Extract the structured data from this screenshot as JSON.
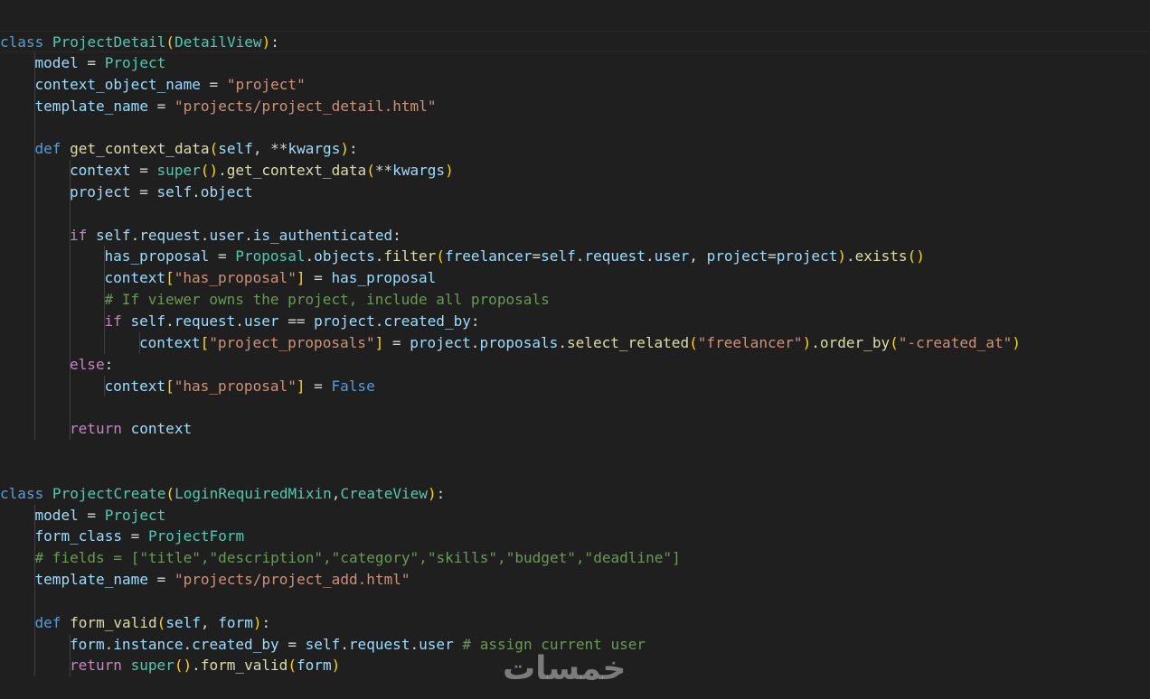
{
  "colors": {
    "background": "#1f1f1f",
    "keyword": "#569cd6",
    "control": "#c586c0",
    "class": "#4ec9b0",
    "function": "#dcdcaa",
    "variable": "#9cdcfe",
    "string": "#ce9178",
    "comment": "#6a9955",
    "bracket_level_1": "#ffd700",
    "bracket_level_2": "#da70d6",
    "bracket_level_3": "#179fff"
  },
  "watermark_text": "خمسات",
  "lines": [
    {
      "indent": 0,
      "current": true,
      "tokens": [
        {
          "t": "class",
          "c": "kw"
        },
        {
          "t": " ",
          "c": "op"
        },
        {
          "t": "ProjectDetail",
          "c": "cls"
        },
        {
          "t": "(",
          "c": "b1"
        },
        {
          "t": "DetailView",
          "c": "cls"
        },
        {
          "t": ")",
          "c": "b1"
        },
        {
          "t": ":",
          "c": "op"
        }
      ]
    },
    {
      "indent": 1,
      "tokens": [
        {
          "t": "model",
          "c": "var"
        },
        {
          "t": " = ",
          "c": "op"
        },
        {
          "t": "Project",
          "c": "cls"
        }
      ]
    },
    {
      "indent": 1,
      "tokens": [
        {
          "t": "context_object_name",
          "c": "var"
        },
        {
          "t": " = ",
          "c": "op"
        },
        {
          "t": "\"project\"",
          "c": "str"
        }
      ]
    },
    {
      "indent": 1,
      "tokens": [
        {
          "t": "template_name",
          "c": "var"
        },
        {
          "t": " = ",
          "c": "op"
        },
        {
          "t": "\"projects/project_detail.html\"",
          "c": "str"
        }
      ]
    },
    {
      "indent": 0,
      "guides": 1,
      "tokens": []
    },
    {
      "indent": 1,
      "tokens": [
        {
          "t": "def",
          "c": "kw"
        },
        {
          "t": " ",
          "c": "op"
        },
        {
          "t": "get_context_data",
          "c": "fn"
        },
        {
          "t": "(",
          "c": "b1"
        },
        {
          "t": "self",
          "c": "var"
        },
        {
          "t": ", **",
          "c": "op"
        },
        {
          "t": "kwargs",
          "c": "var"
        },
        {
          "t": ")",
          "c": "b1"
        },
        {
          "t": ":",
          "c": "op"
        }
      ]
    },
    {
      "indent": 2,
      "tokens": [
        {
          "t": "context",
          "c": "var"
        },
        {
          "t": " = ",
          "c": "op"
        },
        {
          "t": "super",
          "c": "cls"
        },
        {
          "t": "(",
          "c": "b1"
        },
        {
          "t": ")",
          "c": "b1"
        },
        {
          "t": ".",
          "c": "op"
        },
        {
          "t": "get_context_data",
          "c": "fn"
        },
        {
          "t": "(",
          "c": "b1"
        },
        {
          "t": "**",
          "c": "op"
        },
        {
          "t": "kwargs",
          "c": "var"
        },
        {
          "t": ")",
          "c": "b1"
        }
      ]
    },
    {
      "indent": 2,
      "tokens": [
        {
          "t": "project",
          "c": "var"
        },
        {
          "t": " = ",
          "c": "op"
        },
        {
          "t": "self",
          "c": "var"
        },
        {
          "t": ".",
          "c": "op"
        },
        {
          "t": "object",
          "c": "var"
        }
      ]
    },
    {
      "indent": 0,
      "guides": 2,
      "tokens": []
    },
    {
      "indent": 2,
      "tokens": [
        {
          "t": "if",
          "c": "ctl"
        },
        {
          "t": " ",
          "c": "op"
        },
        {
          "t": "self",
          "c": "var"
        },
        {
          "t": ".",
          "c": "op"
        },
        {
          "t": "request",
          "c": "var"
        },
        {
          "t": ".",
          "c": "op"
        },
        {
          "t": "user",
          "c": "var"
        },
        {
          "t": ".",
          "c": "op"
        },
        {
          "t": "is_authenticated",
          "c": "var"
        },
        {
          "t": ":",
          "c": "op"
        }
      ]
    },
    {
      "indent": 3,
      "tokens": [
        {
          "t": "has_proposal",
          "c": "var"
        },
        {
          "t": " = ",
          "c": "op"
        },
        {
          "t": "Proposal",
          "c": "cls"
        },
        {
          "t": ".",
          "c": "op"
        },
        {
          "t": "objects",
          "c": "var"
        },
        {
          "t": ".",
          "c": "op"
        },
        {
          "t": "filter",
          "c": "fn"
        },
        {
          "t": "(",
          "c": "b1"
        },
        {
          "t": "freelancer",
          "c": "var"
        },
        {
          "t": "=",
          "c": "op"
        },
        {
          "t": "self",
          "c": "var"
        },
        {
          "t": ".",
          "c": "op"
        },
        {
          "t": "request",
          "c": "var"
        },
        {
          "t": ".",
          "c": "op"
        },
        {
          "t": "user",
          "c": "var"
        },
        {
          "t": ", ",
          "c": "op"
        },
        {
          "t": "project",
          "c": "var"
        },
        {
          "t": "=",
          "c": "op"
        },
        {
          "t": "project",
          "c": "var"
        },
        {
          "t": ")",
          "c": "b1"
        },
        {
          "t": ".",
          "c": "op"
        },
        {
          "t": "exists",
          "c": "fn"
        },
        {
          "t": "(",
          "c": "b1"
        },
        {
          "t": ")",
          "c": "b1"
        }
      ]
    },
    {
      "indent": 3,
      "tokens": [
        {
          "t": "context",
          "c": "var"
        },
        {
          "t": "[",
          "c": "b1"
        },
        {
          "t": "\"has_proposal\"",
          "c": "str"
        },
        {
          "t": "]",
          "c": "b1"
        },
        {
          "t": " = ",
          "c": "op"
        },
        {
          "t": "has_proposal",
          "c": "var"
        }
      ]
    },
    {
      "indent": 3,
      "tokens": [
        {
          "t": "# If viewer owns the project, include all proposals",
          "c": "cmt"
        }
      ]
    },
    {
      "indent": 3,
      "tokens": [
        {
          "t": "if",
          "c": "ctl"
        },
        {
          "t": " ",
          "c": "op"
        },
        {
          "t": "self",
          "c": "var"
        },
        {
          "t": ".",
          "c": "op"
        },
        {
          "t": "request",
          "c": "var"
        },
        {
          "t": ".",
          "c": "op"
        },
        {
          "t": "user",
          "c": "var"
        },
        {
          "t": " == ",
          "c": "op"
        },
        {
          "t": "project",
          "c": "var"
        },
        {
          "t": ".",
          "c": "op"
        },
        {
          "t": "created_by",
          "c": "var"
        },
        {
          "t": ":",
          "c": "op"
        }
      ]
    },
    {
      "indent": 4,
      "tokens": [
        {
          "t": "context",
          "c": "var"
        },
        {
          "t": "[",
          "c": "b1"
        },
        {
          "t": "\"project_proposals\"",
          "c": "str"
        },
        {
          "t": "]",
          "c": "b1"
        },
        {
          "t": " = ",
          "c": "op"
        },
        {
          "t": "project",
          "c": "var"
        },
        {
          "t": ".",
          "c": "op"
        },
        {
          "t": "proposals",
          "c": "var"
        },
        {
          "t": ".",
          "c": "op"
        },
        {
          "t": "select_related",
          "c": "fn"
        },
        {
          "t": "(",
          "c": "b1"
        },
        {
          "t": "\"freelancer\"",
          "c": "str"
        },
        {
          "t": ")",
          "c": "b1"
        },
        {
          "t": ".",
          "c": "op"
        },
        {
          "t": "order_by",
          "c": "fn"
        },
        {
          "t": "(",
          "c": "b1"
        },
        {
          "t": "\"-created_at\"",
          "c": "str"
        },
        {
          "t": ")",
          "c": "b1"
        }
      ]
    },
    {
      "indent": 2,
      "tokens": [
        {
          "t": "else",
          "c": "ctl"
        },
        {
          "t": ":",
          "c": "op"
        }
      ]
    },
    {
      "indent": 3,
      "tokens": [
        {
          "t": "context",
          "c": "var"
        },
        {
          "t": "[",
          "c": "b1"
        },
        {
          "t": "\"has_proposal\"",
          "c": "str"
        },
        {
          "t": "]",
          "c": "b1"
        },
        {
          "t": " = ",
          "c": "op"
        },
        {
          "t": "False",
          "c": "kw"
        }
      ]
    },
    {
      "indent": 0,
      "guides": 2,
      "tokens": []
    },
    {
      "indent": 2,
      "tokens": [
        {
          "t": "return",
          "c": "ctl"
        },
        {
          "t": " ",
          "c": "op"
        },
        {
          "t": "context",
          "c": "var"
        }
      ]
    },
    {
      "indent": 0,
      "tokens": []
    },
    {
      "indent": 0,
      "tokens": []
    },
    {
      "indent": 0,
      "tokens": [
        {
          "t": "class",
          "c": "kw"
        },
        {
          "t": " ",
          "c": "op"
        },
        {
          "t": "ProjectCreate",
          "c": "cls"
        },
        {
          "t": "(",
          "c": "b1"
        },
        {
          "t": "LoginRequiredMixin",
          "c": "cls"
        },
        {
          "t": ",",
          "c": "op"
        },
        {
          "t": "CreateView",
          "c": "cls"
        },
        {
          "t": ")",
          "c": "b1"
        },
        {
          "t": ":",
          "c": "op"
        }
      ]
    },
    {
      "indent": 1,
      "tokens": [
        {
          "t": "model",
          "c": "var"
        },
        {
          "t": " = ",
          "c": "op"
        },
        {
          "t": "Project",
          "c": "cls"
        }
      ]
    },
    {
      "indent": 1,
      "tokens": [
        {
          "t": "form_class",
          "c": "var"
        },
        {
          "t": " = ",
          "c": "op"
        },
        {
          "t": "ProjectForm",
          "c": "cls"
        }
      ]
    },
    {
      "indent": 1,
      "tokens": [
        {
          "t": "# fields = [\"title\",\"description\",\"category\",\"skills\",\"budget\",\"deadline\"]",
          "c": "cmt"
        }
      ]
    },
    {
      "indent": 1,
      "tokens": [
        {
          "t": "template_name",
          "c": "var"
        },
        {
          "t": " = ",
          "c": "op"
        },
        {
          "t": "\"projects/project_add.html\"",
          "c": "str"
        }
      ]
    },
    {
      "indent": 0,
      "guides": 1,
      "tokens": []
    },
    {
      "indent": 1,
      "tokens": [
        {
          "t": "def",
          "c": "kw"
        },
        {
          "t": " ",
          "c": "op"
        },
        {
          "t": "form_valid",
          "c": "fn"
        },
        {
          "t": "(",
          "c": "b1"
        },
        {
          "t": "self",
          "c": "var"
        },
        {
          "t": ", ",
          "c": "op"
        },
        {
          "t": "form",
          "c": "var"
        },
        {
          "t": ")",
          "c": "b1"
        },
        {
          "t": ":",
          "c": "op"
        }
      ]
    },
    {
      "indent": 2,
      "tokens": [
        {
          "t": "form",
          "c": "var"
        },
        {
          "t": ".",
          "c": "op"
        },
        {
          "t": "instance",
          "c": "var"
        },
        {
          "t": ".",
          "c": "op"
        },
        {
          "t": "created_by",
          "c": "var"
        },
        {
          "t": " = ",
          "c": "op"
        },
        {
          "t": "self",
          "c": "var"
        },
        {
          "t": ".",
          "c": "op"
        },
        {
          "t": "request",
          "c": "var"
        },
        {
          "t": ".",
          "c": "op"
        },
        {
          "t": "user",
          "c": "var"
        },
        {
          "t": " ",
          "c": "op"
        },
        {
          "t": "# assign current user",
          "c": "cmt"
        }
      ]
    },
    {
      "indent": 2,
      "tokens": [
        {
          "t": "return",
          "c": "ctl"
        },
        {
          "t": " ",
          "c": "op"
        },
        {
          "t": "super",
          "c": "cls"
        },
        {
          "t": "(",
          "c": "b1"
        },
        {
          "t": ")",
          "c": "b1"
        },
        {
          "t": ".",
          "c": "op"
        },
        {
          "t": "form_valid",
          "c": "fn"
        },
        {
          "t": "(",
          "c": "b1"
        },
        {
          "t": "form",
          "c": "var"
        },
        {
          "t": ")",
          "c": "b1"
        }
      ]
    }
  ]
}
